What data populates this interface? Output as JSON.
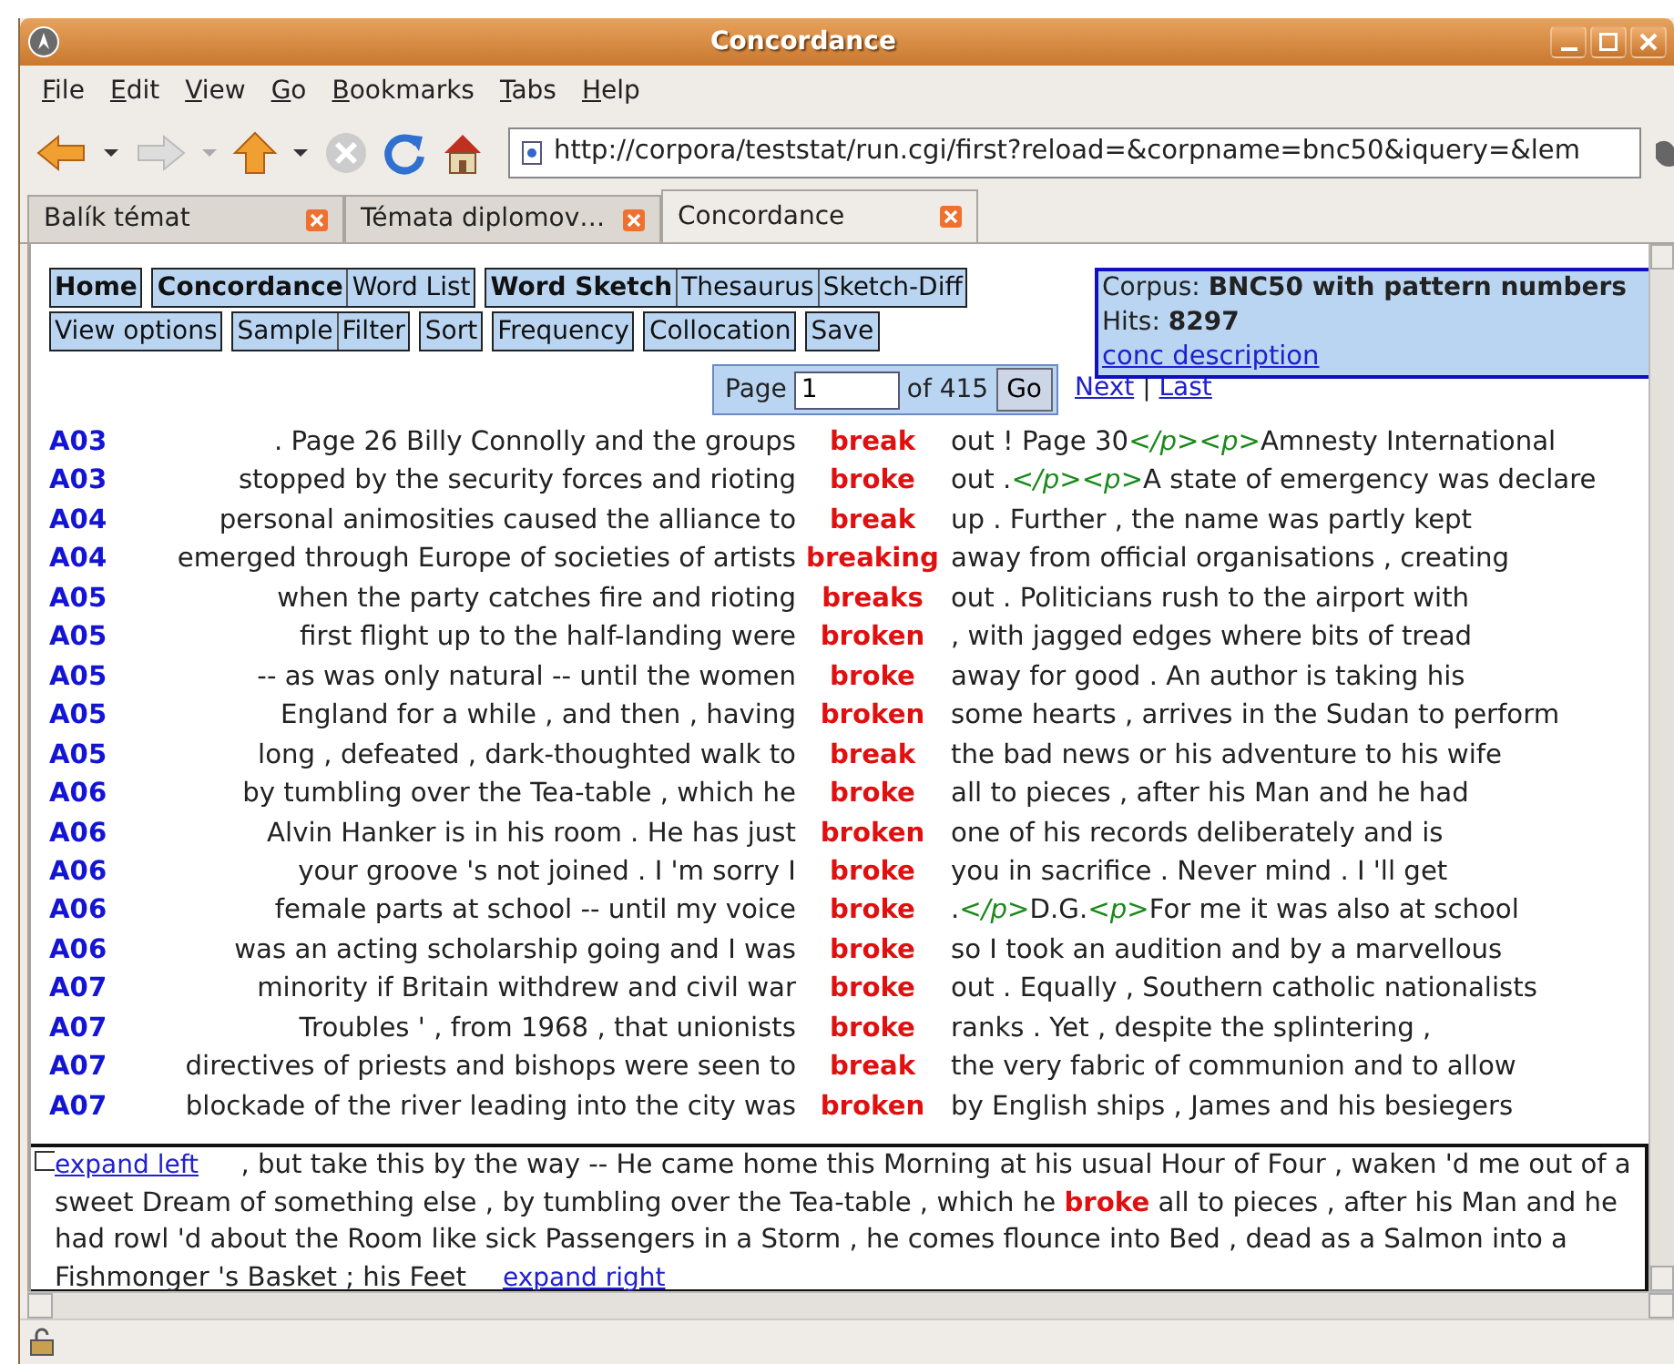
{
  "window": {
    "title": "Concordance"
  },
  "menu": [
    "File",
    "Edit",
    "View",
    "Go",
    "Bookmarks",
    "Tabs",
    "Help"
  ],
  "toolbar": {
    "url": "http://corpora/teststat/run.cgi/first?reload=&corpname=bnc50&iquery=&lem"
  },
  "tabs": [
    {
      "label": "Balík témat",
      "selected": false
    },
    {
      "label": "Témata diplomov…",
      "selected": false
    },
    {
      "label": "Concordance",
      "selected": true
    }
  ],
  "nav": [
    [
      [
        {
          "label": "Home",
          "emphasized": true
        }
      ],
      [
        {
          "label": "Concordance",
          "emphasized": true
        },
        {
          "label": "Word List",
          "emphasized": false
        }
      ],
      [
        {
          "label": "Word Sketch",
          "emphasized": true
        },
        {
          "label": "Thesaurus",
          "emphasized": false
        },
        {
          "label": "Sketch-Diff",
          "emphasized": false
        }
      ]
    ],
    [
      [
        {
          "label": "View options",
          "emphasized": false
        }
      ],
      [
        {
          "label": "Sample",
          "emphasized": false
        },
        {
          "label": "Filter",
          "emphasized": false
        }
      ],
      [
        {
          "label": "Sort",
          "emphasized": false
        }
      ],
      [
        {
          "label": "Frequency",
          "emphasized": false
        }
      ],
      [
        {
          "label": "Collocation",
          "emphasized": false
        }
      ],
      [
        {
          "label": "Save",
          "emphasized": false
        }
      ]
    ]
  ],
  "corpus": {
    "label": "Corpus:",
    "name": "BNC50 with pattern numbers",
    "hits_label": "Hits:",
    "hits": "8297",
    "link": "conc description"
  },
  "pager": {
    "label": "Page",
    "value": "1",
    "total": "of 415",
    "button": "Go",
    "links": [
      "Next",
      "Last"
    ],
    "separator": "|"
  },
  "lines": [
    {
      "ref": "A03",
      "left": ". Page 26 Billy Connolly and the groups",
      "kw": "break",
      "right": [
        {
          "kind": "text",
          "text": "out ! Page 30"
        },
        {
          "kind": "tag",
          "text": "</p><p>"
        },
        {
          "kind": "text",
          "text": "Amnesty International"
        }
      ]
    },
    {
      "ref": "A03",
      "left": "stopped by the security forces and rioting",
      "kw": "broke",
      "right": [
        {
          "kind": "text",
          "text": "out ."
        },
        {
          "kind": "tag",
          "text": "</p><p>"
        },
        {
          "kind": "text",
          "text": "A state of emergency was declare"
        }
      ]
    },
    {
      "ref": "A04",
      "left": "personal animosities caused the alliance to",
      "kw": "break",
      "right": [
        {
          "kind": "text",
          "text": "up . Further , the name was partly kept"
        }
      ]
    },
    {
      "ref": "A04",
      "left": "emerged through Europe of societies of artists",
      "kw": "breaking",
      "right": [
        {
          "kind": "text",
          "text": "away from official organisations , creating"
        }
      ]
    },
    {
      "ref": "A05",
      "left": "when the party catches fire and rioting",
      "kw": "breaks",
      "right": [
        {
          "kind": "text",
          "text": "out . Politicians rush to the airport with"
        }
      ]
    },
    {
      "ref": "A05",
      "left": "first flight up to the half-landing were",
      "kw": "broken",
      "right": [
        {
          "kind": "text",
          "text": ", with jagged edges where bits of tread"
        }
      ]
    },
    {
      "ref": "A05",
      "left": "-- as was only natural -- until the women",
      "kw": "broke",
      "right": [
        {
          "kind": "text",
          "text": "away for good . An author is taking his"
        }
      ]
    },
    {
      "ref": "A05",
      "left": "England for a while , and then , having",
      "kw": "broken",
      "right": [
        {
          "kind": "text",
          "text": "some hearts , arrives in the Sudan to perform"
        }
      ]
    },
    {
      "ref": "A05",
      "left": "long , defeated , dark-thoughted walk to",
      "kw": "break",
      "right": [
        {
          "kind": "text",
          "text": "the bad news or his adventure to his wife"
        }
      ]
    },
    {
      "ref": "A06",
      "left": "by tumbling over the Tea-table , which he",
      "kw": "broke",
      "right": [
        {
          "kind": "text",
          "text": "all to pieces , after his Man and he had"
        }
      ]
    },
    {
      "ref": "A06",
      "left": "Alvin Hanker is in his room . He has just",
      "kw": "broken",
      "right": [
        {
          "kind": "text",
          "text": "one of his records deliberately and is"
        }
      ]
    },
    {
      "ref": "A06",
      "left": "your groove 's not joined . I 'm sorry I",
      "kw": "broke",
      "right": [
        {
          "kind": "text",
          "text": "you in sacrifice . Never mind . I 'll get"
        }
      ]
    },
    {
      "ref": "A06",
      "left": "female parts at school -- until my voice",
      "kw": "broke",
      "right": [
        {
          "kind": "text",
          "text": "."
        },
        {
          "kind": "tag",
          "text": "</p>"
        },
        {
          "kind": "text",
          "text": "D.G."
        },
        {
          "kind": "tag",
          "text": "<p>"
        },
        {
          "kind": "text",
          "text": "For me it was also at school"
        }
      ]
    },
    {
      "ref": "A06",
      "left": "was an acting scholarship going and I was",
      "kw": "broke",
      "right": [
        {
          "kind": "text",
          "text": "so I took an audition and by a marvellous"
        }
      ]
    },
    {
      "ref": "A07",
      "left": "minority if Britain withdrew and civil war",
      "kw": "broke",
      "right": [
        {
          "kind": "text",
          "text": "out . Equally , Southern catholic nationalists"
        }
      ]
    },
    {
      "ref": "A07",
      "left": "Troubles ' , from 1968 , that unionists",
      "kw": "broke",
      "right": [
        {
          "kind": "text",
          "text": "ranks . Yet , despite the splintering ,"
        }
      ]
    },
    {
      "ref": "A07",
      "left": "directives of priests and bishops were seen to",
      "kw": "break",
      "right": [
        {
          "kind": "text",
          "text": "the very fabric of communion and to allow"
        }
      ]
    },
    {
      "ref": "A07",
      "left": "blockade of the river leading into the city was",
      "kw": "broken",
      "right": [
        {
          "kind": "text",
          "text": "by English ships , James and his besiegers"
        }
      ]
    }
  ],
  "popup": {
    "expand_left": "expand left",
    "text": ", but take this by the way -- He came home this Morning at his usual Hour of Four , waken 'd me out of a sweet Dream of something else , by tumbling over the Tea-table , which he **broke** all to pieces , after his Man and he had rowl 'd about the Room like sick Passengers in a Storm , he comes flounce into Bed , dead as a Salmon into a Fishmonger 's Basket ; his Feet",
    "expand_right": "expand right"
  }
}
